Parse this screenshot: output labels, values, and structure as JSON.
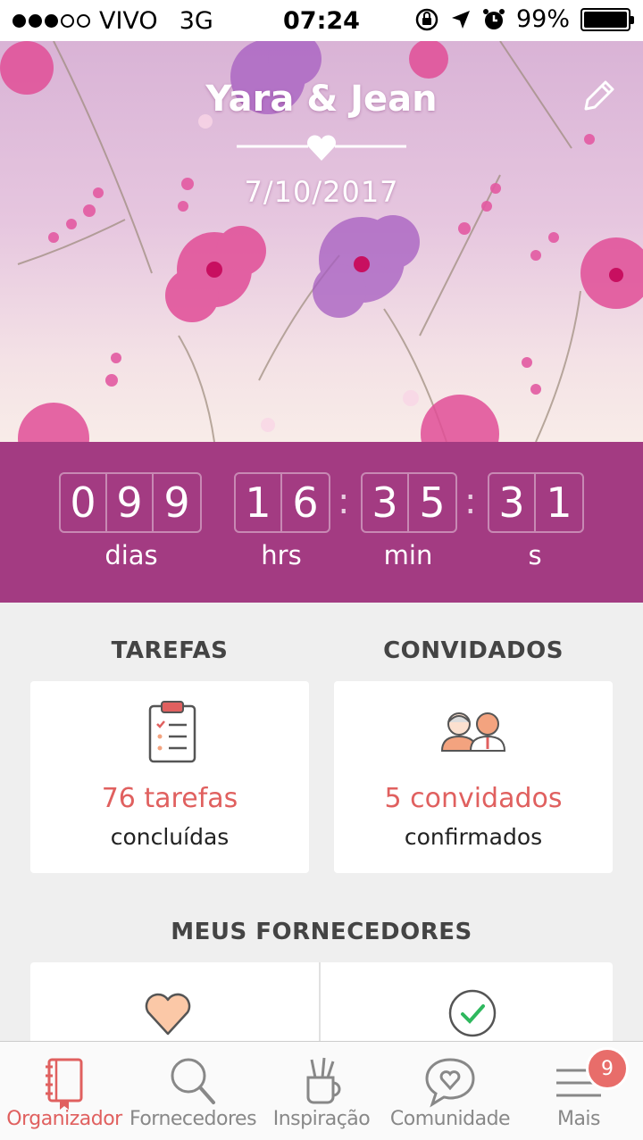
{
  "status_bar": {
    "carrier": "VIVO",
    "network": "3G",
    "time": "07:24",
    "battery": "99%",
    "battery_level": 0.99,
    "signal_dots_filled": 3,
    "icons": [
      "rotation-lock-icon",
      "location-arrow-icon",
      "alarm-icon",
      "battery-icon"
    ]
  },
  "hero": {
    "couple_names": "Yara & Jean",
    "wedding_date": "7/10/2017",
    "edit_icon": "pencil-icon",
    "background_colors": [
      "#d9b3d6",
      "#f8ece8"
    ]
  },
  "countdown": {
    "days": [
      "0",
      "9",
      "9"
    ],
    "hours": [
      "1",
      "6"
    ],
    "minutes": [
      "3",
      "5"
    ],
    "seconds": [
      "3",
      "1"
    ],
    "separator": ":",
    "labels": {
      "days": "dias",
      "hours": "hrs",
      "minutes": "min",
      "seconds": "s"
    },
    "background": "#a33b82"
  },
  "tasks": {
    "title": "TAREFAS",
    "count_text": "76 tarefas",
    "status_text": "concluídas",
    "icon": "clipboard-checklist-icon"
  },
  "guests": {
    "title": "CONVIDADOS",
    "count_text": "5 convidados",
    "status_text": "confirmados",
    "icon": "couple-avatar-icon"
  },
  "providers": {
    "title": "MEUS FORNECEDORES",
    "icons": [
      "heart-icon",
      "checkmark-circle-icon"
    ]
  },
  "tabbar": {
    "tabs": [
      {
        "label": "Organizador",
        "icon": "notebook-icon",
        "active": true
      },
      {
        "label": "Fornecedores",
        "icon": "search-icon",
        "active": false
      },
      {
        "label": "Inspiração",
        "icon": "brush-cup-icon",
        "active": false
      },
      {
        "label": "Comunidade",
        "icon": "chat-heart-icon",
        "active": false
      },
      {
        "label": "Mais",
        "icon": "menu-icon",
        "active": false,
        "badge": "9"
      }
    ]
  },
  "colors": {
    "accent": "#e0605f",
    "primary": "#a33b82",
    "badge": "#e86d6a"
  }
}
